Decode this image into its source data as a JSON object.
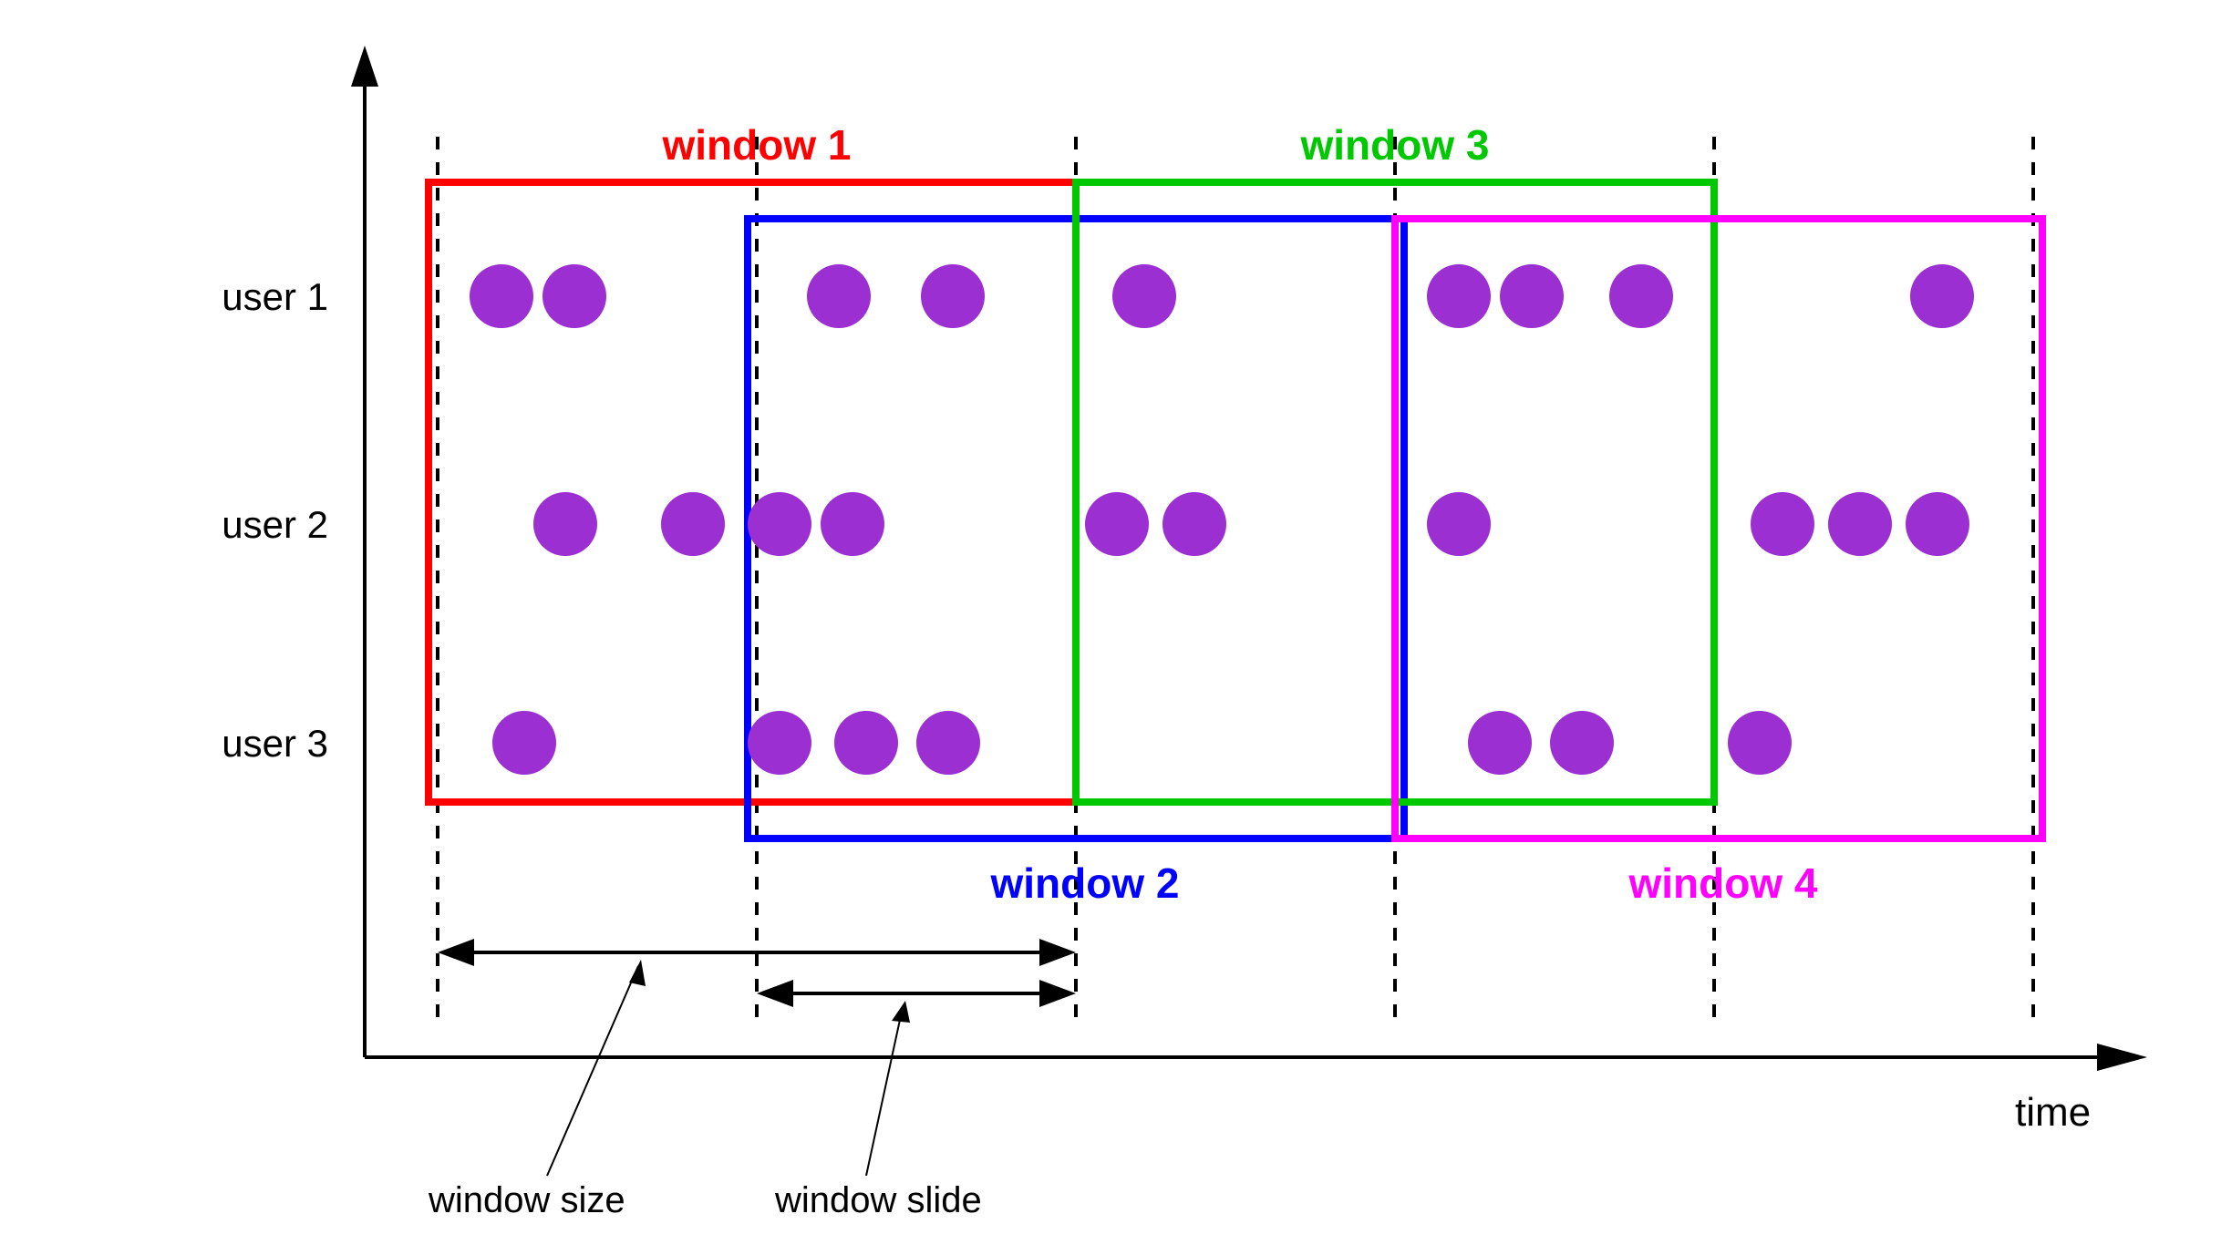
{
  "xlabel": "time",
  "rows": [
    {
      "label": "user 1"
    },
    {
      "label": "user 2"
    },
    {
      "label": "user 3"
    }
  ],
  "windows": [
    {
      "label": "window 1",
      "color": "#ff0000"
    },
    {
      "label": "window 2",
      "color": "#0000ff"
    },
    {
      "label": "window 3",
      "color": "#00c800"
    },
    {
      "label": "window 4",
      "color": "#ff00ff"
    }
  ],
  "annotations": {
    "window_size": "window size",
    "window_slide": "window slide"
  },
  "chart_data": {
    "type": "scatter",
    "series": [
      {
        "name": "user 1",
        "x": [
          0.5,
          1.0,
          3.1,
          4.0,
          5.5,
          8.0,
          8.5,
          9.5,
          11.8
        ]
      },
      {
        "name": "user 2",
        "x": [
          1.0,
          2.0,
          2.6,
          3.2,
          5.3,
          5.9,
          8.0,
          10.5,
          11.0,
          11.6
        ]
      },
      {
        "name": "user 3",
        "x": [
          0.7,
          2.6,
          3.3,
          4.0,
          8.3,
          8.9,
          10.3
        ]
      }
    ],
    "grid_ticks": [
      0,
      2.5,
      5,
      7.5,
      10,
      12.5
    ],
    "windows": [
      {
        "name": "window 1",
        "start": 0,
        "end": 5,
        "color": "#ff0000"
      },
      {
        "name": "window 2",
        "start": 2.5,
        "end": 7.5,
        "color": "#0000ff"
      },
      {
        "name": "window 3",
        "start": 5,
        "end": 10,
        "color": "#00c800"
      },
      {
        "name": "window 4",
        "start": 7.5,
        "end": 12.5,
        "color": "#ff00ff"
      }
    ],
    "window_size": 5,
    "window_slide": 2.5
  }
}
